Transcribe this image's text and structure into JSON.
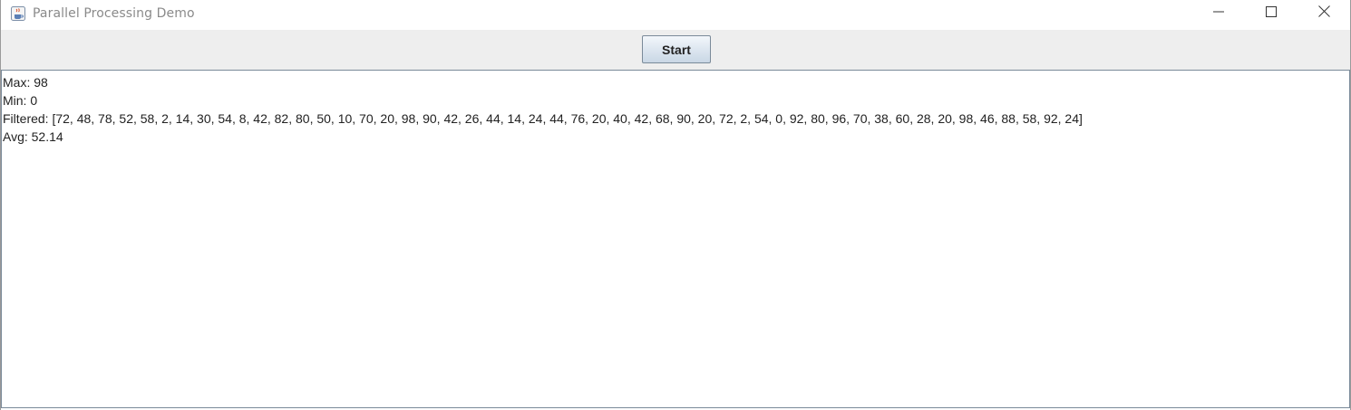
{
  "window": {
    "title": "Parallel Processing Demo",
    "app_icon": "java-cup-icon",
    "controls": {
      "minimize_icon": "minimize-icon",
      "maximize_icon": "maximize-icon",
      "close_icon": "close-icon"
    }
  },
  "toolbar": {
    "start_label": "Start"
  },
  "output": {
    "lines": [
      "Max: 98",
      "Min: 0",
      "Filtered: [72, 48, 78, 52, 58, 2, 14, 30, 54, 8, 42, 82, 80, 50, 10, 70, 20, 98, 90, 42, 26, 44, 14, 24, 44, 76, 20, 40, 42, 68, 90, 20, 72, 2, 54, 0, 92, 80, 96, 70, 38, 60, 28, 20, 98, 46, 88, 58, 92, 24]",
      "Avg: 52.14"
    ]
  },
  "colors": {
    "toolbar_bg": "#eeeeee",
    "border": "#7a8a99",
    "title_text": "#8a8a8a"
  }
}
